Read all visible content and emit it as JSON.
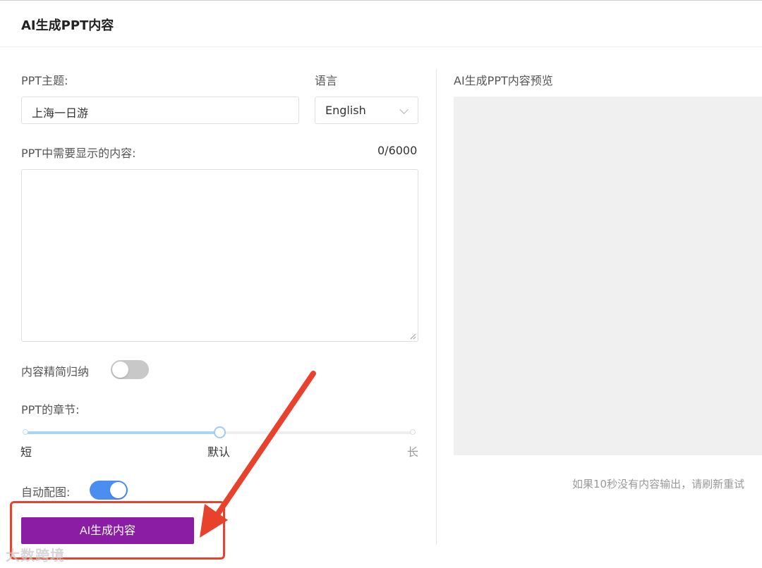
{
  "header": {
    "title": "AI生成PPT内容"
  },
  "form": {
    "topic_label": "PPT主题:",
    "topic_value": "上海一日游",
    "language_label": "语言",
    "language_selected": "English",
    "content_label": "PPT中需要显示的内容:",
    "content_counter": "0/6000",
    "content_value": "",
    "summarize_label": "内容精简归纳",
    "summarize_on": false,
    "chapters_label": "PPT的章节:",
    "chapters_options": [
      "短",
      "默认",
      "长"
    ],
    "chapters_level": 0.5,
    "auto_image_label": "自动配图:",
    "auto_image_on": true,
    "generate_button": "AI生成内容"
  },
  "preview": {
    "title": "AI生成PPT内容预览",
    "hint": "如果10秒没有内容输出，请刷新重试"
  },
  "watermark": "大数跨境",
  "colors": {
    "button": "#8a1da3",
    "toggle_on": "#4a8ff0",
    "annotation": "#e8412c"
  }
}
